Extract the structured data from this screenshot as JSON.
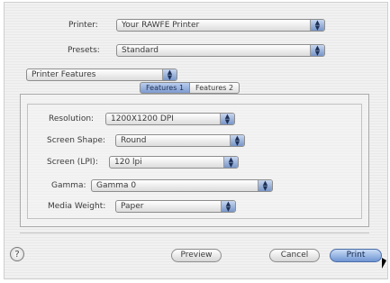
{
  "printer": {
    "label": "Printer:",
    "value": "Your RAWFE Printer"
  },
  "presets": {
    "label": "Presets:",
    "value": "Standard"
  },
  "section": {
    "value": "Printer Features"
  },
  "tabs": [
    {
      "label": "Features 1"
    },
    {
      "label": "Features 2"
    }
  ],
  "settings": {
    "resolution": {
      "label": "Resolution:",
      "value": "1200X1200 DPI"
    },
    "screen_shape": {
      "label": "Screen Shape:",
      "value": "Round"
    },
    "screen_lpi": {
      "label": "Screen (LPI):",
      "value": "120 lpi"
    },
    "gamma": {
      "label": "Gamma:",
      "value": "Gamma 0"
    },
    "media_weight": {
      "label": "Media Weight:",
      "value": "Paper"
    }
  },
  "footer": {
    "help": "?",
    "preview": "Preview",
    "cancel": "Cancel",
    "print": "Print"
  },
  "icons": {
    "popup_arrows": "updown-arrows-icon",
    "help": "question-icon"
  },
  "colors": {
    "accent": "#7896c8",
    "default_button": "#6f95d2"
  }
}
